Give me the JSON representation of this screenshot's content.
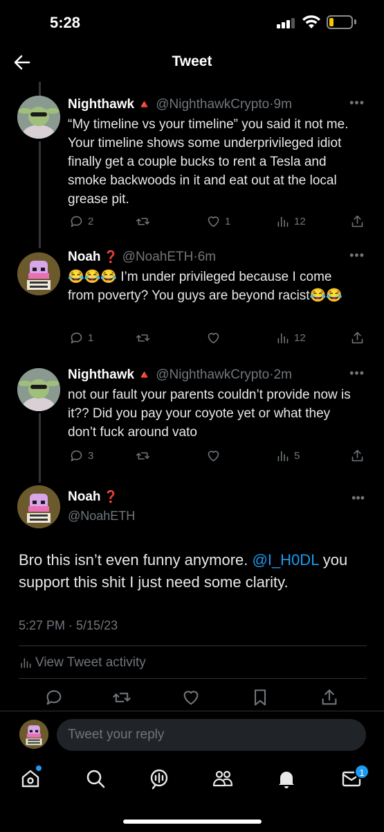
{
  "status": {
    "time": "5:28"
  },
  "header": {
    "title": "Tweet"
  },
  "replies": [
    {
      "name": "Nighthawk",
      "badge": "🔺",
      "handle": "@NighthawkCrypto",
      "dot": "·",
      "age": "9m",
      "text": "“My timeline vs your timeline” you said it not me. Your timeline shows some underprivileged idiot finally get a couple bucks to rent a Tesla and smoke backwoods in it and eat out at the local grease pit.",
      "reply_count": "2",
      "retweet_count": "",
      "like_count": "1",
      "view_count": "12"
    },
    {
      "name": "Noah",
      "badge": "❓",
      "handle": "@NoahETH",
      "dot": "·",
      "age": "6m",
      "text": "😂😂😂 I’m under privileged because I come from poverty? You guys are beyond racist😂😂",
      "reply_count": "1",
      "retweet_count": "",
      "like_count": "",
      "view_count": "12"
    },
    {
      "name": "Nighthawk",
      "badge": "🔺",
      "handle": "@NighthawkCrypto",
      "dot": "·",
      "age": "2m",
      "text": "not our fault your parents couldn’t provide now is it?? Did you pay your coyote yet or what they don’t fuck around vato",
      "reply_count": "3",
      "retweet_count": "",
      "like_count": "",
      "view_count": "5"
    }
  ],
  "main_tweet": {
    "name": "Noah",
    "badge": "❓",
    "handle": "@NoahETH",
    "text_before": "Bro this isn’t even funny anymore. ",
    "mention": "@I_H0DL",
    "text_after": " you support this shit I just need some clarity.",
    "timestamp": "5:27 PM · 5/15/23",
    "activity_label": "View Tweet activity"
  },
  "reply_bar": {
    "placeholder": "Tweet your reply"
  },
  "tabs": {
    "messages_badge": "1"
  },
  "colors": {
    "background": "#000000",
    "text": "#e7e9ea",
    "muted": "#71767b",
    "accent": "#1d9bf0"
  },
  "icons": {
    "back": "arrow-left-icon",
    "more": "more-dots-icon",
    "reply": "speech-bubble-icon",
    "retweet": "retweet-icon",
    "like": "heart-icon",
    "views": "bar-chart-icon",
    "share": "share-icon",
    "bookmark": "bookmark-icon",
    "home": "home-icon",
    "search": "search-icon",
    "spaces": "spaces-icon",
    "communities": "communities-icon",
    "notifications": "bell-icon",
    "messages": "envelope-icon"
  }
}
